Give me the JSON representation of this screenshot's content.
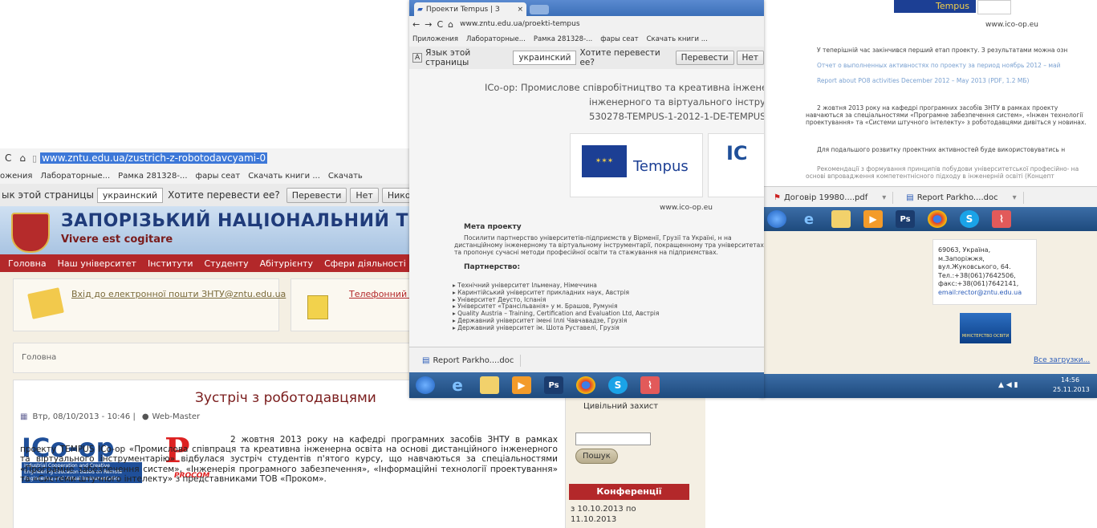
{
  "left": {
    "url": "www.zntu.edu.ua/zustrich-z-robotodavcyami-0",
    "bookmarks": [
      "ожения",
      "Лабораторные...",
      "Рамка 281328-...",
      "фары сеат",
      "Скачать книги ...",
      "Скачать"
    ],
    "translate": {
      "prompt": "ык этой страницы",
      "lang": "украинский",
      "question": "Хотите перевести ее?",
      "translate": "Перевести",
      "no": "Нет",
      "never": "Никогда"
    },
    "site_title": "ЗАПОРІЗЬКИЙ НАЦІОНАЛЬНИЙ ТЕХНІЧНИ",
    "motto": "Vivere est cogitare",
    "nav": [
      "Головна",
      "Наш університет",
      "Інститути",
      "Студенту",
      "Абітурієнту",
      "Сфери діяльності"
    ],
    "mail_link": "Вхід до електронної пошти ЗНТУ@zntu.edu.ua",
    "phone_link": "Телефонний д",
    "breadcrumb": "Головна",
    "article_title": "Зустріч з роботодавцями",
    "meta_date": "Втр, 08/10/2013 - 10:46 |",
    "meta_author": "Web-Master",
    "logo_text": "ICo-op",
    "logo_sub": [
      "Industrial Cooperation and Creative",
      "Engineering Education based on Remote",
      "Engineering and Virtual Instrumentation"
    ],
    "procom": "PROCOM",
    "body": "2 жовтня 2013 року на кафедрі програмних засобів ЗНТУ в рамках проекту TEMPUS ICo-op «Промислова співпраця та креативна інженерна освіта на основі дистанційного інженерного та віртуального інструментарію» відбулася зустріч студентів п'ятого курсу, що навчаються за спеціальностями «Програмне забезпечення систем», «Інженерія програмного забезпечення», «Інформаційні технології проектування» та «Системи штучного інтелекту» з представниками ТОВ «Проком».",
    "sidebar_link": "Цивільний захист",
    "search_btn": "Пошук",
    "conf_title": "Конференції",
    "conf_dates": [
      "з 10.10.2013 по",
      "11.10.2013"
    ]
  },
  "middle": {
    "tab": "Проекти Tempus | З",
    "url": "www.zntu.edu.ua/proekti-tempus",
    "bookmarks": [
      "Приложения",
      "Лабораторные...",
      "Рамка 281328-...",
      "фары сеат",
      "Скачать книги ..."
    ],
    "translate": {
      "prompt": "Язык этой страницы",
      "lang": "украинский",
      "question": "Хотите перевести ее?",
      "translate": "Перевести",
      "no": "Нет"
    },
    "heading": [
      "ICo-op: Промислове співробітництво та креативна інженерна",
      "інженерного та віртуального інструме",
      "530278-TEMPUS-1-2012-1-DE-TEMPUS"
    ],
    "tempus": "Tempus",
    "ic": "IC",
    "site": "www.ico-op.eu",
    "goal_title": "Мета проекту",
    "goal_text": "Посилити партнерство університетів-підприємств у Вірменії, Грузії та Україні, н на дистанційному інженерному та віртуальному інструментарії, покращенному тра університетах та пропонує сучасні методи професійної освіти та стажування на підприємствах.",
    "partners_title": "Партнерство:",
    "partners": [
      "Технічний університет Ільменау, Німеччина",
      "Каринтійський університет прикладних наук, Австрія",
      "Університет Деусто, Іспанія",
      "Університет «Трансільванія» у м. Брашов, Румунія",
      "Quality Austria – Training, Certification and Evaluation Ltd, Австрія",
      "Державний університет імені Іллі Чавчавадзе, Грузія",
      "Державний університет ім. Шота Руставелі, Грузія"
    ],
    "download": "Report Parkho....doc"
  },
  "right": {
    "tempus": "Tempus",
    "site": "www.ico-op.eu",
    "p1": "У теперішній час закінчився перший етап проекту. З результатами можна озн",
    "link1": "Отчет о выполненных активностях по проекту за период ноябрь 2012 – май",
    "link2": "Report about PO8 activities December 2012 – May 2013 (PDF, 1.2 МБ)",
    "p2": "2 жовтня 2013 року на кафедрі програмних засобів ЗНТУ в рамках проекту навчаються за спеціальностями «Програмне забезпечення систем», «Інжен технології проектування» та «Системи штучного інтелекту» з роботодавцями дивіться у новинах.",
    "p3": "Для подальшого розвитку проектних активностей буде використовуватись н",
    "p4": "Рекомендації з формування принципів побудови університетської професійно- на основі впровадження компетентнісного підходу в інженерній освіті (Концепт",
    "downloads": [
      "Договір 19980....pdf",
      "Report Parkho....doc"
    ],
    "address": [
      "69063, Україна,",
      "м.Запоріжжя,",
      "вул.Жуковського, 64.",
      "Тел.:+38(061)7642506,",
      "факс:+38(061)7642141,",
      "email:rector@zntu.edu.ua"
    ],
    "ministry": "МІНІСТЕРСТВО ОСВІТИ",
    "all_downloads": "Все загрузки...",
    "time": "14:56",
    "date": "25.11.2013"
  }
}
